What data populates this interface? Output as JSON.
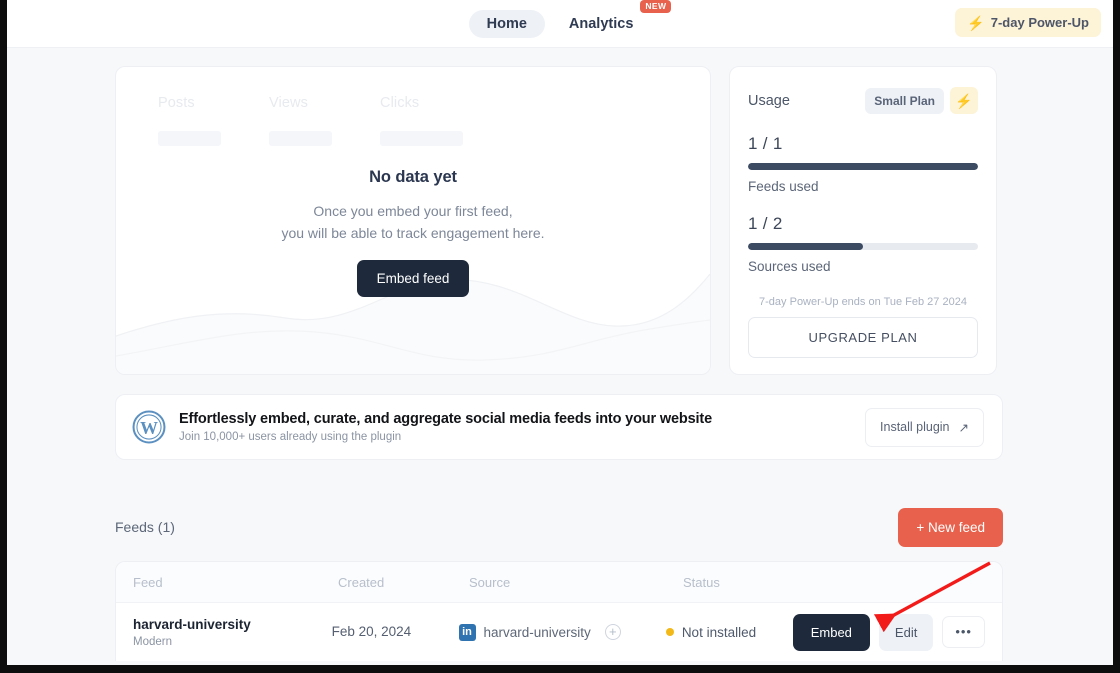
{
  "topbar": {
    "nav": [
      {
        "label": "Home",
        "active": true
      },
      {
        "label": "Analytics",
        "active": false,
        "badge": "NEW"
      }
    ],
    "powerup": {
      "label": "7-day Power-Up",
      "icon": "bolt-icon"
    }
  },
  "analytics_card": {
    "stats": [
      {
        "label": "Posts"
      },
      {
        "label": "Views"
      },
      {
        "label": "Clicks"
      }
    ],
    "empty_title": "No data yet",
    "empty_line1": "Once you embed your first feed,",
    "empty_line2": "you will be able to track engagement here.",
    "embed_button": "Embed feed"
  },
  "usage_card": {
    "title": "Usage",
    "plan_label": "Small Plan",
    "plan_bolt_icon": "bolt-icon",
    "metrics": [
      {
        "value": "1 / 1",
        "caption": "Feeds used",
        "percent": 100
      },
      {
        "value": "1 / 2",
        "caption": "Sources used",
        "percent": 50
      }
    ],
    "note": "7-day Power-Up ends on Tue Feb 27 2024",
    "upgrade_button": "UPGRADE PLAN"
  },
  "banner": {
    "icon": "wordpress-icon",
    "title": "Effortlessly embed, curate, and aggregate social media feeds into your website",
    "subtitle": "Join 10,000+ users already using the plugin",
    "cta": "Install plugin",
    "cta_icon": "external-link-icon"
  },
  "feeds": {
    "section_title": "Feeds (1)",
    "new_feed_button": "+ New feed",
    "columns": [
      "Feed",
      "Created",
      "Source",
      "Status"
    ],
    "rows": [
      {
        "name": "harvard-university",
        "theme": "Modern",
        "created": "Feb 20, 2024",
        "source_icon": "linkedin-icon",
        "source_icon_text": "in",
        "source": "harvard-university",
        "add_source_icon": "plus-circle-icon",
        "status": "Not installed",
        "status_color": "#f3b919",
        "actions": {
          "embed": "Embed",
          "edit": "Edit",
          "more": "•••"
        }
      }
    ]
  },
  "annotation": {
    "arrow_color": "#f31a1a"
  },
  "colors": {
    "accent_red": "#e8614c",
    "dark": "#1e2a3b",
    "page_bg": "#f7f8fa"
  }
}
